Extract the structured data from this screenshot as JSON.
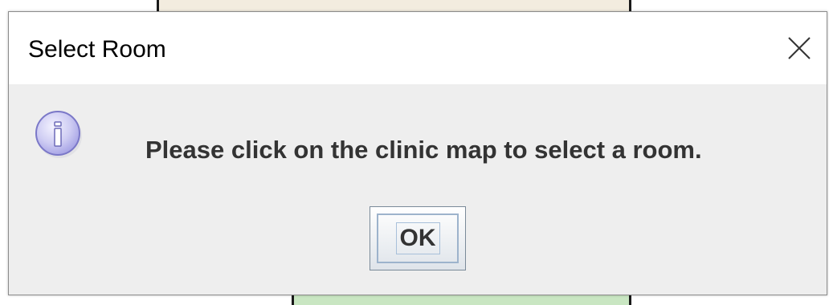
{
  "dialog": {
    "title": "Select Room",
    "message": "Please click on the clinic map to select a room.",
    "ok_label": "OK",
    "icons": {
      "close": "close-icon",
      "info": "info-icon"
    }
  },
  "colors": {
    "titlebar_bg": "#ffffff",
    "content_bg": "#eeeeee",
    "message_text": "#333333",
    "info_icon_fill": "#c9c6f0",
    "info_icon_stroke": "#7b78c8",
    "ok_border": "#7a8a99"
  }
}
